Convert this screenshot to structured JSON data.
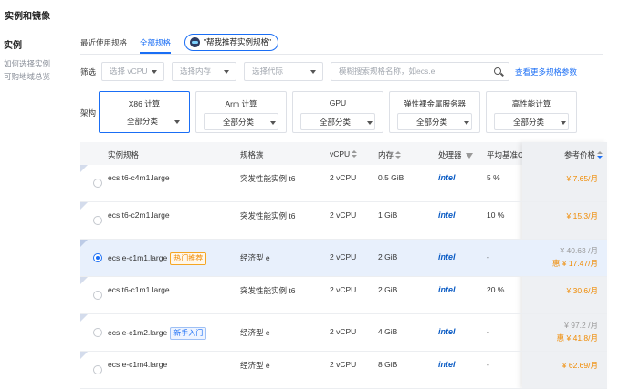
{
  "page_title": "实例和镜像",
  "sidebar": {
    "section": "实例",
    "links": [
      "如何选择实例",
      "可购地域总览"
    ]
  },
  "tabs": [
    {
      "label": "最近使用规格",
      "active": false
    },
    {
      "label": "全部规格",
      "active": true
    }
  ],
  "recommend_button": "\"帮我推荐实例规格\"",
  "filter": {
    "label": "筛选",
    "vcpu": "选择 vCPU",
    "memory": "选择内存",
    "generation": "选择代际",
    "search_placeholder": "模糊搜索规格名称，如ecs.e",
    "more_link": "查看更多规格参数"
  },
  "arch": {
    "label": "架构",
    "cards": [
      {
        "name": "X86 计算",
        "sub": "全部分类",
        "active": true
      },
      {
        "name": "Arm 计算",
        "sub": "全部分类",
        "active": false
      },
      {
        "name": "GPU",
        "sub": "全部分类",
        "active": false
      },
      {
        "name": "弹性裸金属服务器",
        "sub": "全部分类",
        "active": false
      },
      {
        "name": "高性能计算",
        "sub": "全部分类",
        "active": false
      }
    ]
  },
  "table": {
    "headers": {
      "spec": "实例规格",
      "family": "规格族",
      "vcpu": "vCPU",
      "memory": "内存",
      "cpu": "处理器",
      "baseline": "平均基准CI",
      "price": "参考价格"
    },
    "rows": [
      {
        "spec": "ecs.t6-c4m1.large",
        "tag": "",
        "family": "突发性能实例 t6",
        "vcpu": "2 vCPU",
        "memory": "0.5 GiB",
        "cpu": "intel",
        "baseline": "5 %",
        "price": "¥ 7.65/月",
        "orig_price": "",
        "selected": false
      },
      {
        "spec": "ecs.t6-c2m1.large",
        "tag": "",
        "family": "突发性能实例 t6",
        "vcpu": "2 vCPU",
        "memory": "1 GiB",
        "cpu": "intel",
        "baseline": "10 %",
        "price": "¥ 15.3/月",
        "orig_price": "",
        "selected": false
      },
      {
        "spec": "ecs.e-c1m1.large",
        "tag": "热门推荐",
        "tag_type": "hot",
        "family": "经济型 e",
        "vcpu": "2 vCPU",
        "memory": "2 GiB",
        "cpu": "intel",
        "baseline": "-",
        "price": "惠 ¥ 17.47/月",
        "orig_price": "¥ 40.63 /月",
        "selected": true
      },
      {
        "spec": "ecs.t6-c1m1.large",
        "tag": "",
        "family": "突发性能实例 t6",
        "vcpu": "2 vCPU",
        "memory": "2 GiB",
        "cpu": "intel",
        "baseline": "20 %",
        "price": "¥ 30.6/月",
        "orig_price": "",
        "selected": false
      },
      {
        "spec": "ecs.e-c1m2.large",
        "tag": "新手入门",
        "tag_type": "new",
        "family": "经济型 e",
        "vcpu": "2 vCPU",
        "memory": "4 GiB",
        "cpu": "intel",
        "baseline": "-",
        "price": "惠 ¥ 41.8/月",
        "orig_price": "¥ 97.2 /月",
        "selected": false
      },
      {
        "spec": "ecs.e-c1m4.large",
        "tag": "",
        "family": "经济型 e",
        "vcpu": "2 vCPU",
        "memory": "8 GiB",
        "cpu": "intel",
        "baseline": "-",
        "price": "¥ 62.69/月",
        "orig_price": "",
        "selected": false
      }
    ]
  },
  "colors": {
    "accent": "#1a6ef5",
    "price": "#f08a00",
    "selected_row": "#e8f0fc"
  }
}
